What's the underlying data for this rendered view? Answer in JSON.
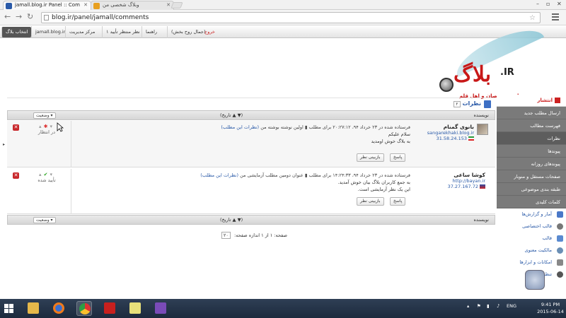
{
  "browser": {
    "tabs": [
      {
        "label": "jamall.blog.ir Panel :: Com"
      },
      {
        "label": "وبلاگ شخصی من"
      }
    ],
    "url": "blog.ir/panel/jamall/comments"
  },
  "adminbar": {
    "choose_blog": "انتخاب بلاگ",
    "blog_domain": "jamall.blog.ir",
    "admin_center": "مرکز مدیریت",
    "pending": "۱ نظر منتظر تأیید",
    "guide": "راهنما",
    "logout": "خروج",
    "user": "(جمال روح بخش)"
  },
  "header": {
    "brand": "بلاگ",
    "brand_suffix": ".IR",
    "tagline": "رسانه متخصصان و اهل قلم"
  },
  "panel": {
    "title": "نظرات",
    "count": "۲",
    "col_author": "نویسنده",
    "col_date": "(تاریخ ▲ ▼)",
    "col_status": "وضعیت ▾"
  },
  "comments": [
    {
      "author": "بانوی گمنام",
      "site": "sangarekhaki.blog.ir",
      "ip": "31.58.24.153",
      "meta": "فرستاده شده در ۲۳ خرداد ۹۴، ۲۰:۲۷:۱۲ برای مطلب",
      "post_title": "اولین نوشته بوشته من",
      "post_link": "(نظرات این مطلب)",
      "body_lines": [
        "سلام علیکم",
        "به بلاگ خوش اومدید"
      ],
      "status": "در انتظار",
      "reply": "پاسخ",
      "review": "بازبینی نظر"
    },
    {
      "author": "کوشا ساعی",
      "site": "http://bayan.ir",
      "ip": "37.27.167.72",
      "meta": "فرستاده شده در ۲۳ خرداد ۹۴، ۱۴:۲۴:۳۳ برای مطلب",
      "post_title": "عنوان دومین مطلب آزمایشی من",
      "post_link": "(نظرات این مطلب)",
      "body_lines": [
        "به جمع کاربران بلاگ بیان خوش آمدید.",
        "این یک نظر آزمایشی است."
      ],
      "status": "تأیید شده",
      "reply": "پاسخ",
      "review": "بازبینی نظر"
    }
  ],
  "pager": {
    "text": "صفحه: ۱ از ۱ اندازه صفحه:",
    "size": "۲۰"
  },
  "sidebar": {
    "head": "انتشار",
    "items": [
      "ارسال مطلب جدید",
      "فهرست مطالب",
      "نظرات",
      "پیوندها",
      "پیوندهای روزانه",
      "صفحات مستقل و منوبار",
      "طبقه بندی موضوعی",
      "کلمات کلیدی"
    ],
    "items2": [
      "آمار و گزارش‌ها",
      "قالب اختصاصی",
      "قالب",
      "مالکیت معنوی",
      "امکانات و ابزارها",
      "تنظیمات"
    ]
  },
  "taskbar": {
    "lang": "ENG",
    "time": "9:41 PM",
    "date": "2015-06-14"
  }
}
